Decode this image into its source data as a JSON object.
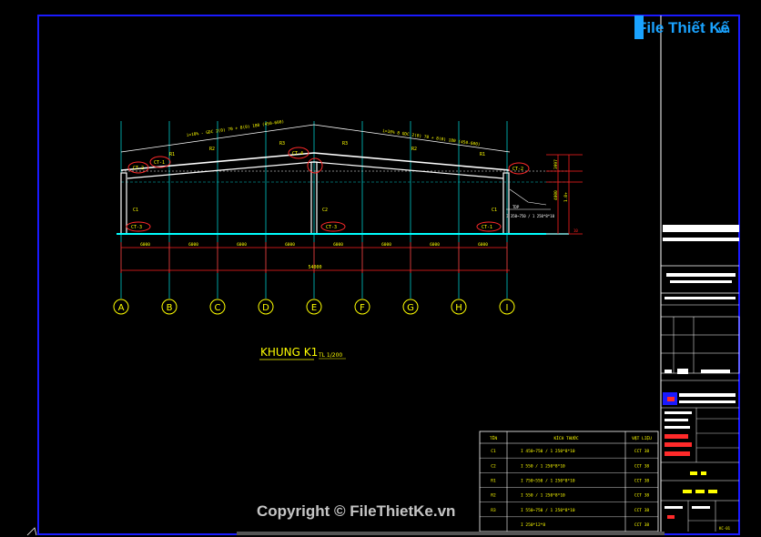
{
  "watermark_logo": {
    "brand": "File Thiết Kế",
    "domain": ".vn"
  },
  "watermark_copyright": "Copyright © FileThietKe.vn",
  "drawing": {
    "title": "KHUNG K1",
    "scale": "TL 1/200",
    "total_span": "54000",
    "grid_axes": [
      "A",
      "B",
      "C",
      "D",
      "E",
      "F",
      "G",
      "H",
      "I"
    ],
    "bay_dims": [
      "6000",
      "6000",
      "6000",
      "6000",
      "6000",
      "6000",
      "6000",
      "6000"
    ],
    "roof_note_left": "i=10% - GDC 2(0) 70 + 8(0) 180 (450-600)",
    "roof_note_right": "i=10% 8 GDC 2(0) 70 + 8(0) 180 (450-600)",
    "rafter_labels": [
      "R1",
      "R2",
      "R3",
      "R3",
      "R2",
      "R1"
    ],
    "section_tags": [
      "CT-2",
      "CT-1",
      "CT-4",
      "CT-2",
      "CT-3",
      "CT-3",
      "CT-1"
    ],
    "column_labels": [
      "C1",
      "C2",
      "C1"
    ],
    "leader_note": "TDP",
    "leader_note2": "I 350~750 / 1 250*8*10",
    "right_dims": [
      "3997",
      "4000",
      "1.0+",
      "10"
    ]
  },
  "materials_table": {
    "headers": [
      "TÊN",
      "KÍCH THƯỚC",
      "VẬT LIỆU"
    ],
    "rows": [
      {
        "name": "C1",
        "size": "I 450~750 / 1 250*8*10",
        "material": "CCT 38"
      },
      {
        "name": "C2",
        "size": "I 550 / 1 250*8*10",
        "material": "CCT 38"
      },
      {
        "name": "R1",
        "size": "I 750~550 / 1 250*8*10",
        "material": "CCT 38"
      },
      {
        "name": "R2",
        "size": "I 550 / 1 250*8*10",
        "material": "CCT 38"
      },
      {
        "name": "R3",
        "size": "I 550~750 / 1 250*8*10",
        "material": "CCT 38"
      },
      {
        "name": "",
        "size": "I 250*12*8",
        "material": "CCT 38"
      }
    ]
  },
  "title_block": {
    "sheet_code": "KC-01"
  },
  "colors": {
    "frame_border": "#1a1aff",
    "structure": "#ffffff",
    "grid_lines": "#00c8c8",
    "floor_line": "#00ffff",
    "dimensions": "#ff2020",
    "grid_bubbles": "#ffff00",
    "annotation_yellow": "#ffff00",
    "red_highlight": "#ff2a2a"
  }
}
